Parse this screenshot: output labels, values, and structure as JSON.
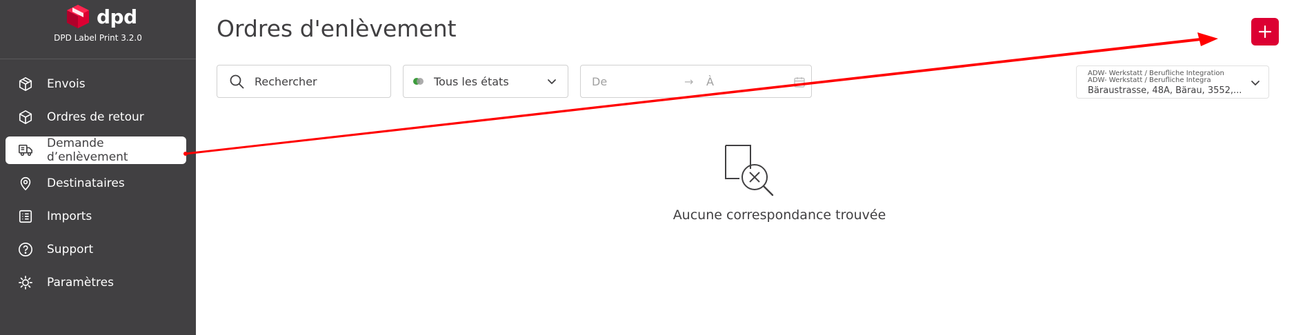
{
  "app": {
    "brand": "dpd",
    "version": "DPD Label Print 3.2.0"
  },
  "sidebar": {
    "items": [
      {
        "label": "Envois",
        "icon": "box-icon"
      },
      {
        "label": "Ordres de retour",
        "icon": "box-return-icon"
      },
      {
        "label": "Demande d’enlèvement",
        "icon": "truck-icon",
        "active": true
      },
      {
        "label": "Destinataires",
        "icon": "location-pin-icon"
      },
      {
        "label": "Imports",
        "icon": "list-icon"
      },
      {
        "label": "Support",
        "icon": "help-icon"
      },
      {
        "label": "Paramètres",
        "icon": "gear-icon"
      }
    ]
  },
  "main": {
    "title": "Ordres d'enlèvement",
    "add_button_icon": "plus-icon",
    "filters": {
      "search_placeholder": "Rechercher",
      "status_label": "Tous les états",
      "date_from": "De",
      "date_arrow": "→",
      "date_to": "À",
      "address_line1": "ADW- Werkstatt / Berufliche Integration",
      "address_line2": "ADW- Werkstatt / Berufliche Integra",
      "address_line3": "Bäraustrasse, 48A, Bärau, 3552,..."
    },
    "empty_state": {
      "message": "Aucune correspondance trouvée",
      "icon": "no-results-icon"
    }
  },
  "colors": {
    "sidebar_bg": "#414042",
    "accent": "#dc0032",
    "status_dot_green": "#3c9c3c",
    "status_dot_grey": "#9e9e9e",
    "annotation_arrow": "#ff0000"
  }
}
